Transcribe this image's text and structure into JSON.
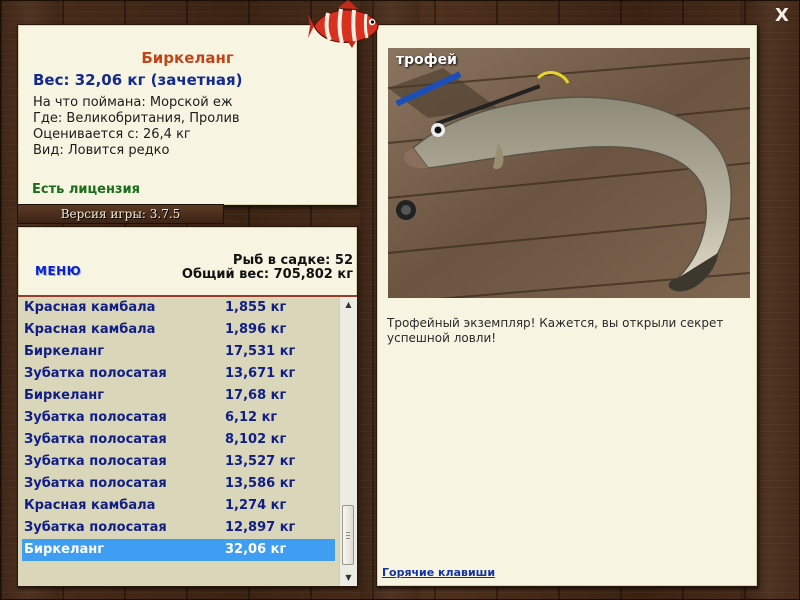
{
  "window": {
    "close_label": "X"
  },
  "fish_info": {
    "name": "Биркеланг",
    "weight": "Вес: 32,06 кг (зачетная)",
    "bait": "На что поймана: Морской еж",
    "location": "Где: Великобритания, Пролив",
    "valued_from": "Оценивается с: 26,4 кг",
    "rarity": "Вид: Ловится редко",
    "license": "Есть лицензия"
  },
  "version": "Версия игры: 3.7.5",
  "keepnet": {
    "menu_label": "МЕНЮ",
    "fish_count": "Рыб в садке: 52",
    "total_weight": "Общий вес: 705,802 кг",
    "catches": [
      {
        "name": "Красная камбала",
        "weight": "1,855 кг"
      },
      {
        "name": "Красная камбала",
        "weight": "1,896 кг"
      },
      {
        "name": "Биркеланг",
        "weight": "17,531 кг"
      },
      {
        "name": "Зубатка полосатая",
        "weight": "13,671 кг"
      },
      {
        "name": "Биркеланг",
        "weight": "17,68 кг"
      },
      {
        "name": "Зубатка полосатая",
        "weight": "6,12 кг"
      },
      {
        "name": "Зубатка полосатая",
        "weight": "8,102 кг"
      },
      {
        "name": "Зубатка полосатая",
        "weight": "13,527 кг"
      },
      {
        "name": "Зубатка полосатая",
        "weight": "13,586 кг"
      },
      {
        "name": "Красная камбала",
        "weight": "1,274 кг"
      },
      {
        "name": "Зубатка полосатая",
        "weight": "12,897 кг"
      },
      {
        "name": "Биркеланг",
        "weight": "32,06 кг"
      }
    ],
    "selected_index": 11
  },
  "trophy": {
    "label": "трофей",
    "caption": "Трофейный экземпляр! Кажется, вы открыли секрет успешной ловли!",
    "hotkeys_link": "Горячие клавиши"
  },
  "colors": {
    "panel_bg": "#f7f4e2",
    "list_bg": "#d9d6b9",
    "selected_row": "#3f9ef2",
    "fish_name": "#c0461a",
    "list_text": "#101e86",
    "license": "#1a6e1a"
  },
  "icons": {
    "close": "close-icon",
    "logo": "red-striped-fish-logo",
    "scroll_up": "scroll-up-arrow-icon",
    "scroll_down": "scroll-down-arrow-icon"
  }
}
